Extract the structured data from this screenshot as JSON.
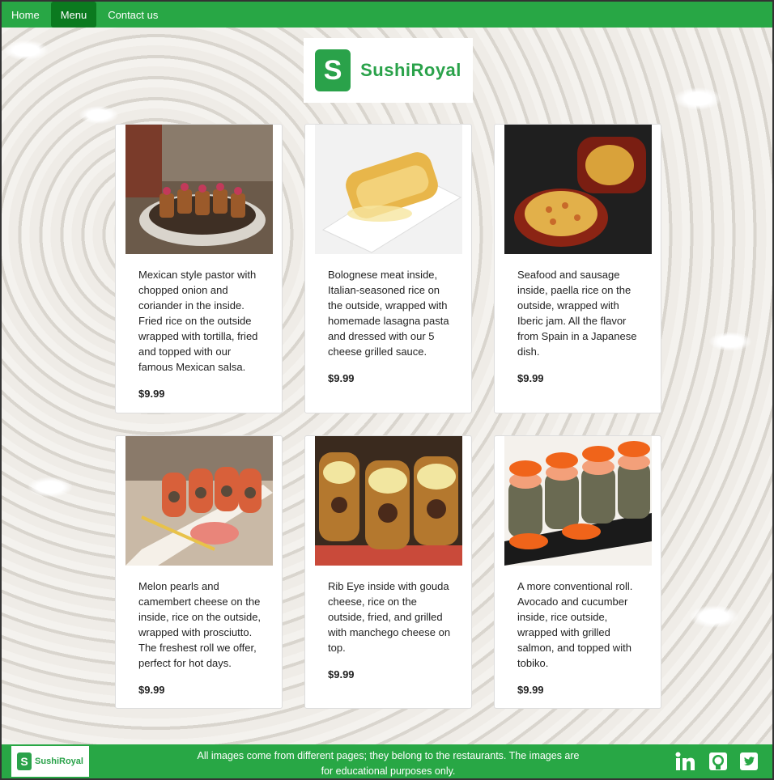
{
  "nav": {
    "items": [
      {
        "label": "Home",
        "active": false
      },
      {
        "label": "Menu",
        "active": true
      },
      {
        "label": "Contact us",
        "active": false
      }
    ]
  },
  "brand": {
    "name": "SushiRoyal",
    "mark": "S",
    "color": "#2aa24a"
  },
  "menu": {
    "cards": [
      {
        "description": "Mexican style pastor with chopped onion and coriander in the inside. Fried rice on the outside wrapped with tortilla, fried and topped with our famous Mexican salsa.",
        "price": "$9.99"
      },
      {
        "description": "Bolognese meat inside, Italian-seasoned rice on the outside, wrapped with homemade lasagna pasta and dressed with our 5 cheese grilled sauce.",
        "price": "$9.99"
      },
      {
        "description": "Seafood and sausage inside, paella rice on the outside, wrapped with Iberic jam. All the flavor from Spain in a Japanese dish.",
        "price": "$9.99"
      },
      {
        "description": "Melon pearls and camembert cheese on the inside, rice on the outside, wrapped with prosciutto. The freshest roll we offer, perfect for hot days.",
        "price": "$9.99"
      },
      {
        "description": "Rib Eye inside with gouda cheese, rice on the outside, fried, and grilled with manchego cheese on top.",
        "price": "$9.99"
      },
      {
        "description": "A more conventional roll. Avocado and cucumber inside, rice outside, wrapped with grilled salmon, and topped with tobiko.",
        "price": "$9.99"
      }
    ]
  },
  "footer": {
    "text": "All images come from different pages; they belong to the restaurants. The images are for educational purposes only.",
    "social": [
      "linkedin-icon",
      "github-icon",
      "twitter-icon"
    ]
  },
  "colors": {
    "nav_bg": "#28a745",
    "nav_active": "#0b7a1f"
  }
}
